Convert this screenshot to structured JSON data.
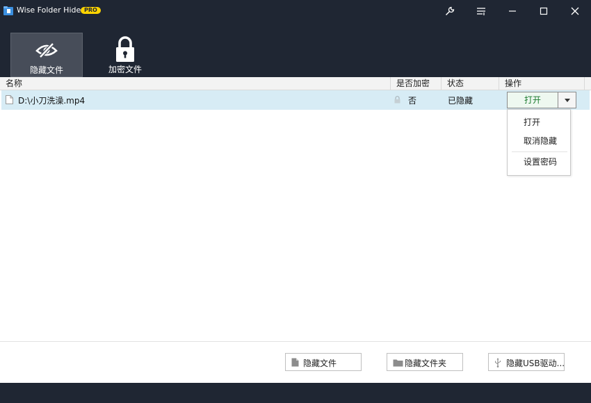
{
  "app": {
    "title": "Wise Folder Hider",
    "badge": "PRO",
    "accent_color": "#ffd400",
    "titlebar_color": "#1f2633"
  },
  "window_controls": [
    {
      "name": "tools-icon"
    },
    {
      "name": "menu-icon"
    },
    {
      "name": "minimize-icon"
    },
    {
      "name": "maximize-icon"
    },
    {
      "name": "close-icon"
    }
  ],
  "toolbar": {
    "items": [
      {
        "label": "隐藏文件",
        "icon": "eye-slash-icon",
        "active": true
      },
      {
        "label": "加密文件",
        "icon": "padlock-icon",
        "active": false
      }
    ]
  },
  "table": {
    "columns": [
      "名称",
      "是否加密",
      "状态",
      "操作"
    ],
    "rows": [
      {
        "name": "D:\\小刀洗澡.mp4",
        "encrypted": "否",
        "status": "已隐藏",
        "action": "打开"
      }
    ]
  },
  "dropdown_menu": {
    "items": [
      "打开",
      "取消隐藏",
      "设置密码"
    ]
  },
  "actions": [
    {
      "label": "隐藏文件",
      "icon": "file-icon"
    },
    {
      "label": "隐藏文件夹",
      "icon": "folder-icon"
    },
    {
      "label": "隐藏USB驱动...",
      "icon": "usb-icon"
    }
  ]
}
